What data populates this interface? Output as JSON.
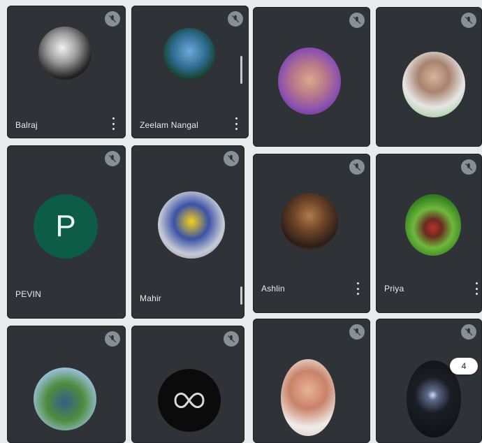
{
  "participants": [
    {
      "name": "Balraj",
      "avatar": "photo"
    },
    {
      "name": "Zeelam Nangal",
      "avatar": "photo"
    },
    {
      "name": "",
      "avatar": "photo"
    },
    {
      "name": "",
      "avatar": "photo"
    },
    {
      "name": "PEVIN",
      "avatar": "letter",
      "letter": "P"
    },
    {
      "name": "Mahir",
      "avatar": "photo"
    },
    {
      "name": "Ashlin",
      "avatar": "photo"
    },
    {
      "name": "Priya",
      "avatar": "photo"
    },
    {
      "name": "",
      "avatar": "photo"
    },
    {
      "name": "",
      "avatar": "infinity"
    },
    {
      "name": "",
      "avatar": "photo"
    },
    {
      "name": "",
      "avatar": "photo"
    }
  ],
  "overflow_badge": {
    "count": "4"
  },
  "colors": {
    "tile_bg": "#2f3337",
    "letter_avatar_bg": "#0d5c45",
    "mute_icon_bg": "#9aa0a6",
    "name_text": "#e8eaed"
  },
  "icons": {
    "mute": "mic-off-icon",
    "more": "more-vert-icon"
  }
}
